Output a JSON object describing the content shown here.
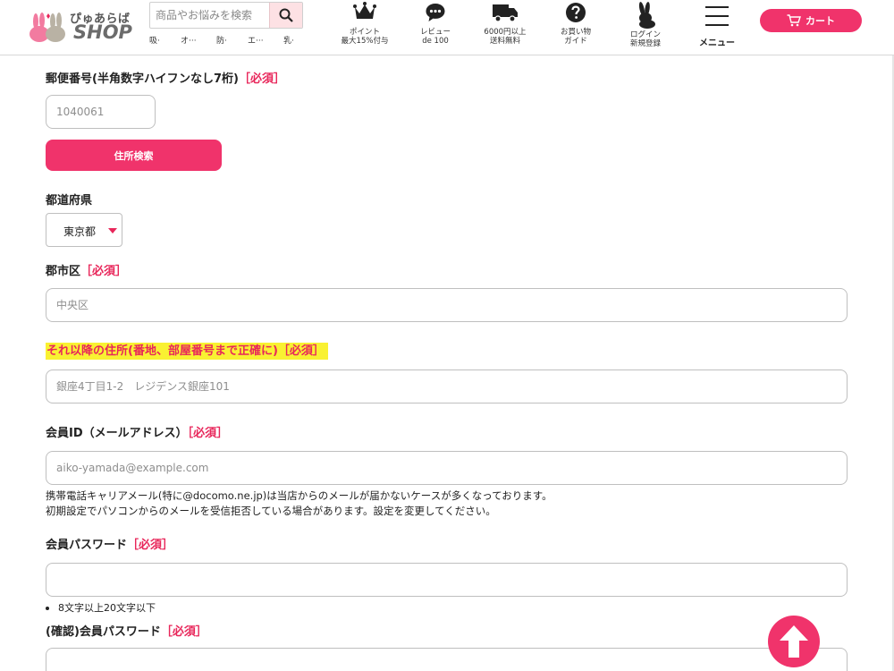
{
  "header": {
    "logo_text": "ぴゅあらば",
    "logo_shop": "SHOP",
    "search_placeholder": "商品やお悩みを検索",
    "keywords": [
      "吸·",
      "オ···",
      "防·",
      "エ···",
      "乳·"
    ],
    "nav": [
      {
        "icon": "crown-icon",
        "line1": "ポイント",
        "line2": "最大15%付与"
      },
      {
        "icon": "chat-bubble-icon",
        "line1": "レビュー",
        "line2": "de 100"
      },
      {
        "icon": "truck-icon",
        "line1": "6000円以上",
        "line2": "送料無料"
      },
      {
        "icon": "question-icon",
        "line1": "お買い物",
        "line2": "ガイド"
      },
      {
        "icon": "rabbit-icon",
        "line1": "ログイン",
        "line2": "新規登録"
      }
    ],
    "menu_label": "メニュー",
    "cart_label": "カート",
    "accent": "#f0336b"
  },
  "form": {
    "postal_label": "郵便番号(半角数字ハイフンなし7桁)",
    "postal_req": "［必須］",
    "postal_placeholder": "1040061",
    "address_search_button": "住所検索",
    "prefecture_label": "都道府県",
    "prefecture_value": "東京都",
    "city_label": "郡市区",
    "city_req": "［必須］",
    "city_placeholder": "中央区",
    "street_label": "それ以降の住所(番地、部屋番号まで正確に)",
    "street_req": "［必須］",
    "street_placeholder": "銀座4丁目1-2　レジデンス銀座101",
    "member_id_label": "会員ID（メールアドレス）",
    "member_id_req": "［必須］",
    "member_id_placeholder": "aiko-yamada@example.com",
    "email_note_1": "携帯電話キャリアメール(特に@docomo.ne.jp)は当店からのメールが届かないケースが多くなっております。",
    "email_note_2": "初期設定でパソコンからのメールを受信拒否している場合があります。設定を変更してください。",
    "password_label": "会員パスワード",
    "password_req": "［必須］",
    "password_rule": "8文字以上20文字以下",
    "password_confirm_label": "(確認)会員パスワード",
    "password_confirm_req": "［必須］"
  }
}
